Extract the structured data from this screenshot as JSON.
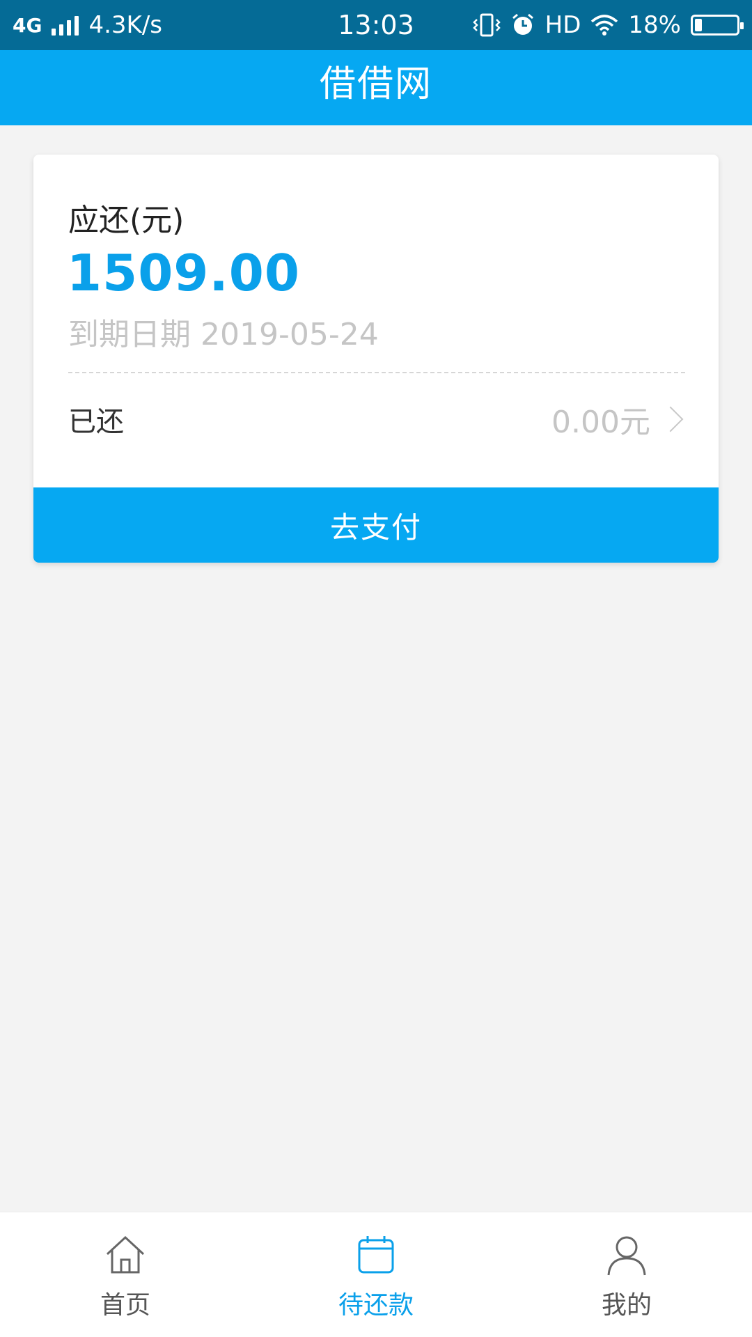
{
  "status_bar": {
    "network": "4G",
    "speed": "4.3K/s",
    "time": "13:03",
    "hd": "HD",
    "battery": "18%"
  },
  "app_bar": {
    "title": "借借网"
  },
  "repayment": {
    "due_label": "应还(元)",
    "due_amount": "1509.00",
    "due_date_text": "到期日期 2019-05-24",
    "paid_label": "已还",
    "paid_amount": "0.00元",
    "pay_button": "去支付"
  },
  "bottom_nav": {
    "items": [
      {
        "label": "首页",
        "icon": "home-icon"
      },
      {
        "label": "待还款",
        "icon": "calendar-icon"
      },
      {
        "label": "我的",
        "icon": "user-icon"
      }
    ],
    "active_index": 1
  },
  "colors": {
    "status_bar": "#056b96",
    "primary": "#06a8f2",
    "amount": "#0aa0ea",
    "background": "#f3f3f3"
  }
}
